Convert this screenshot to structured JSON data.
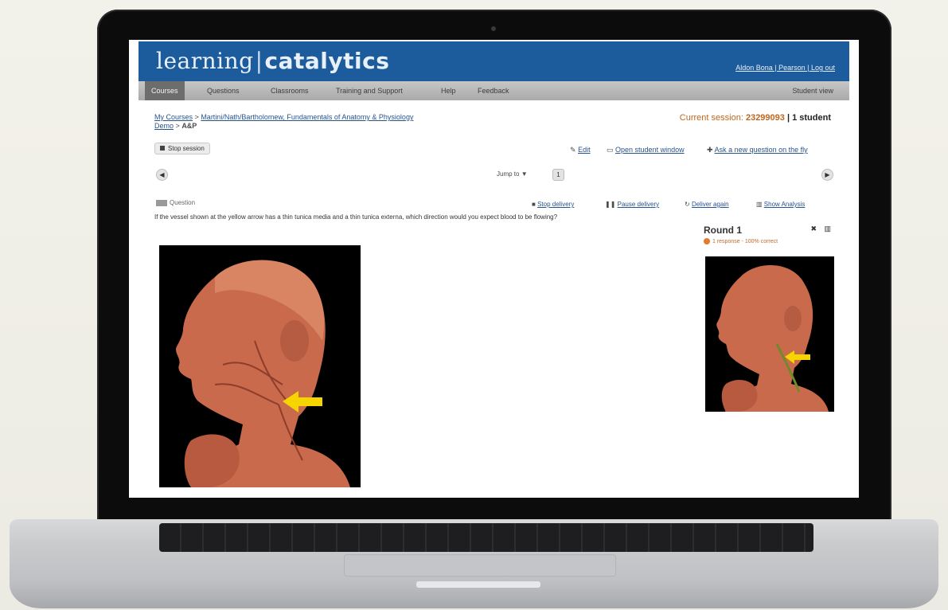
{
  "brand": {
    "left": "learning",
    "right": "catalytics"
  },
  "header": {
    "user_links": "Aldon Bona | Pearson | Log out"
  },
  "nav": {
    "items": [
      "Courses",
      "Questions",
      "Classrooms",
      "Training and Support",
      "Help",
      "Feedback"
    ],
    "student_view": "Student view"
  },
  "breadcrumb": {
    "root": "My Courses",
    "sep": ">",
    "course": "Martini/Nath/Bartholomew, Fundamentals of Anatomy & Physiology",
    "course_line2": "Demo",
    "current": "A&P"
  },
  "session": {
    "label": "Current session:",
    "id": "23299093",
    "students": "| 1 student"
  },
  "toolbar": {
    "stop_session": "Stop session",
    "edit": "Edit",
    "open_student_window": "Open student window",
    "ask_new_question": "Ask a new question on the fly",
    "jump": "Jump to",
    "jump_arrow": "▼",
    "prev": "◀",
    "next": "▶",
    "counter": "1"
  },
  "question": {
    "tag": "Question",
    "actions": [
      "Stop delivery",
      "Pause delivery",
      "Deliver again",
      "Show Analysis"
    ],
    "text": "If the vessel shown at the yellow arrow has a thin tunica media and a thin tunica externa, which direction would you expect blood to be flowing?"
  },
  "round": {
    "title": "Round 1",
    "summary": "1 response - 100% correct"
  },
  "colors": {
    "brand_blue": "#1d5c9c",
    "session_orange": "#c0661c",
    "response_dot": "#e37b2c"
  },
  "icons": [
    "stop-icon",
    "edit-icon",
    "window-icon",
    "plus-icon",
    "prev-icon",
    "next-icon",
    "square-icon",
    "pause-icon",
    "refresh-icon",
    "chart-icon",
    "close-icon"
  ]
}
